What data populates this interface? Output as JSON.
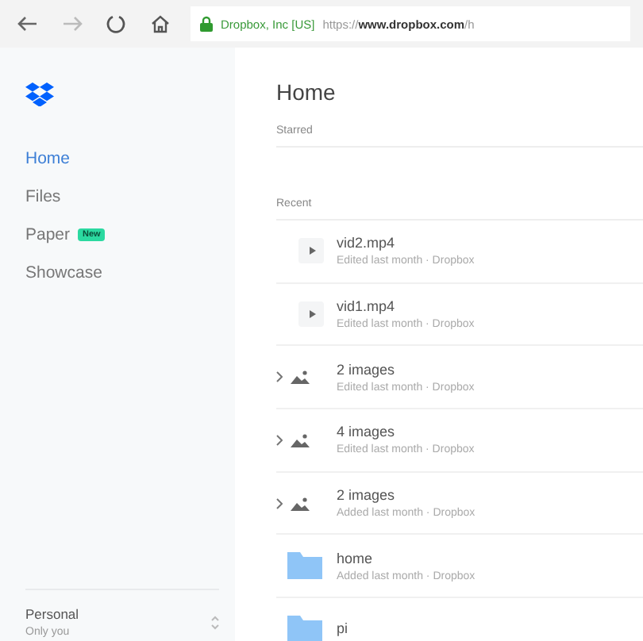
{
  "browser": {
    "site_identity": "Dropbox, Inc [US]",
    "url": "https://**www.dropbox.com**/h"
  },
  "sidebar": {
    "items": [
      {
        "label": "Home",
        "selected": true
      },
      {
        "label": "Files",
        "selected": false
      },
      {
        "label": "Paper",
        "selected": false,
        "badge": "New"
      },
      {
        "label": "Showcase",
        "selected": false
      }
    ],
    "account": {
      "name": "Personal",
      "subtitle": "Only you"
    }
  },
  "main": {
    "title": "Home",
    "starred_heading": "Starred",
    "recent_heading": "Recent",
    "recent": [
      {
        "kind": "video",
        "name": "vid2.mp4",
        "meta": "Edited last month · Dropbox"
      },
      {
        "kind": "video",
        "name": "vid1.mp4",
        "meta": "Edited last month · Dropbox"
      },
      {
        "kind": "images",
        "name": "2 images",
        "meta": "Edited last month · Dropbox"
      },
      {
        "kind": "images",
        "name": "4 images",
        "meta": "Edited last month · Dropbox"
      },
      {
        "kind": "images",
        "name": "2 images",
        "meta": "Added last month · Dropbox"
      },
      {
        "kind": "folder",
        "name": "home",
        "meta": "Added last month · Dropbox"
      },
      {
        "kind": "folder",
        "name": "pi"
      }
    ]
  }
}
